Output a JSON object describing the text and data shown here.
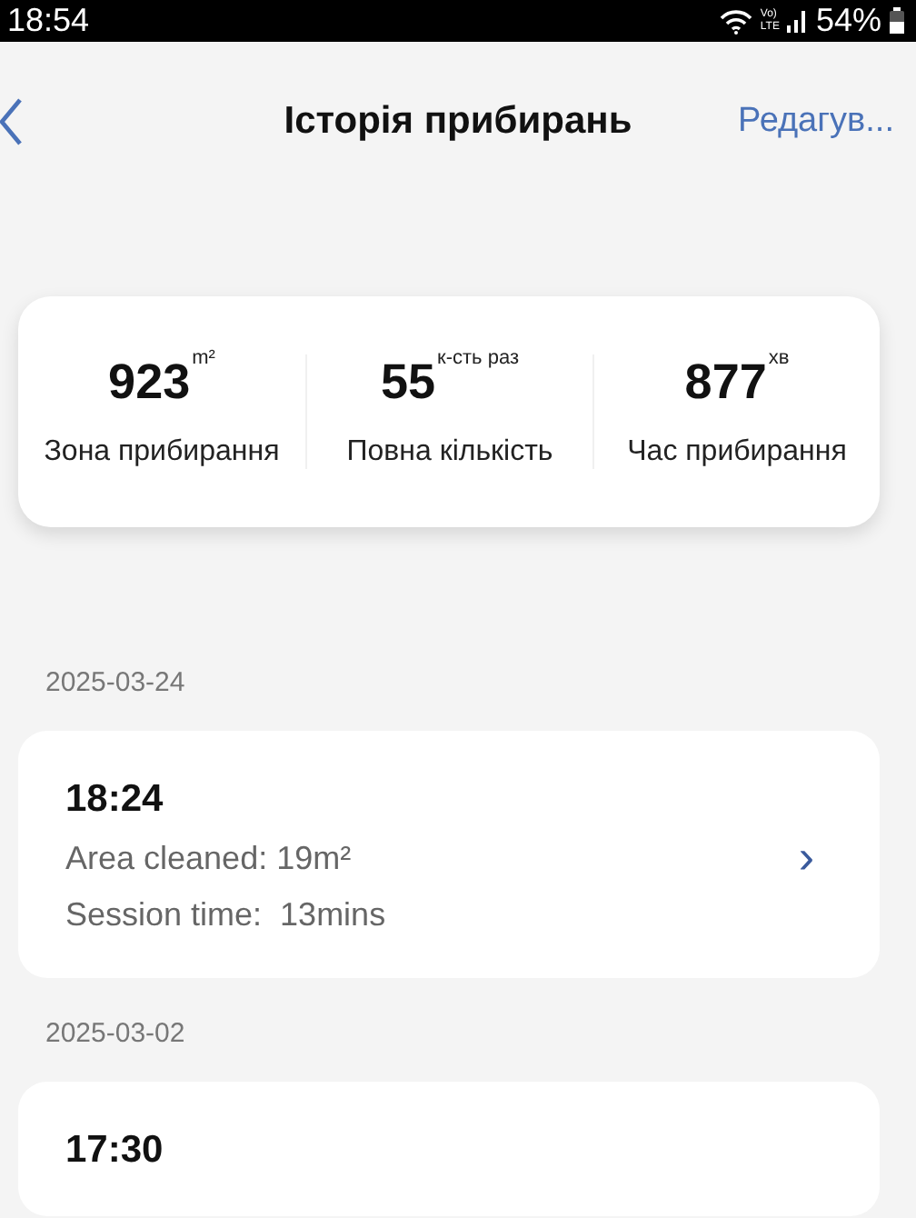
{
  "status_bar": {
    "time": "18:54",
    "network_label": [
      "Vo)",
      "LTE"
    ],
    "battery": "54%"
  },
  "header": {
    "title": "Історія прибирань",
    "action": "Редагув..."
  },
  "summary": [
    {
      "value": "923",
      "unit": "m²",
      "label": "Зона прибирання"
    },
    {
      "value": "55",
      "unit": "к-сть раз",
      "label": "Повна кількість"
    },
    {
      "value": "877",
      "unit": "хв",
      "label": "Час прибирання"
    }
  ],
  "sessions": [
    {
      "date": "2025-03-24",
      "time": "18:24",
      "area": "Area cleaned: 19m²",
      "duration": "Session time:  13mins",
      "chevron": "›"
    },
    {
      "date": "2025-03-02",
      "time": "17:30"
    }
  ]
}
